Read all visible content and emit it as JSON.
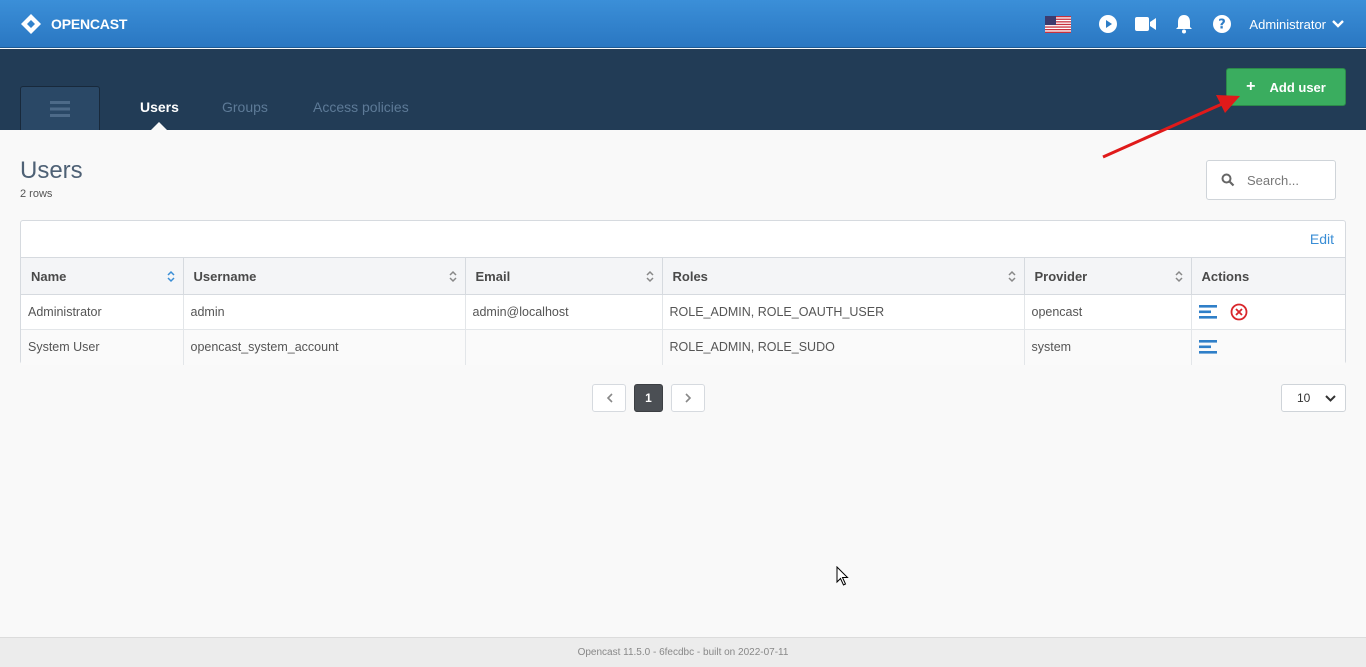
{
  "header": {
    "brand": "OPENCAST",
    "language_icon": "us-flag-icon",
    "user_menu_label": "Administrator"
  },
  "nav": {
    "tabs": [
      {
        "label": "Users",
        "active": true
      },
      {
        "label": "Groups",
        "active": false
      },
      {
        "label": "Access policies",
        "active": false
      }
    ],
    "add_button_label": "Add user"
  },
  "page": {
    "title": "Users",
    "row_count": "2 rows",
    "search_placeholder": "Search...",
    "edit_label": "Edit"
  },
  "table": {
    "columns": [
      "Name",
      "Username",
      "Email",
      "Roles",
      "Provider",
      "Actions"
    ],
    "rows": [
      {
        "name": "Administrator",
        "username": "admin",
        "email": "admin@localhost",
        "roles": "ROLE_ADMIN, ROLE_OAUTH_USER",
        "provider": "opencast",
        "actions": [
          "details-icon",
          "delete-icon"
        ]
      },
      {
        "name": "System User",
        "username": "opencast_system_account",
        "email": "",
        "roles": "ROLE_ADMIN, ROLE_SUDO",
        "provider": "system",
        "actions": [
          "details-icon"
        ]
      }
    ]
  },
  "pagination": {
    "current_page": "1",
    "page_size": "10"
  },
  "footer": {
    "text": "Opencast 11.5.0 - 6fecdbc - built on 2022-07-11"
  },
  "colors": {
    "topbar": "#2f82cc",
    "navband": "#223c56",
    "add_button": "#3aad5f",
    "link": "#3a8ed6",
    "delete": "#d9262b"
  }
}
